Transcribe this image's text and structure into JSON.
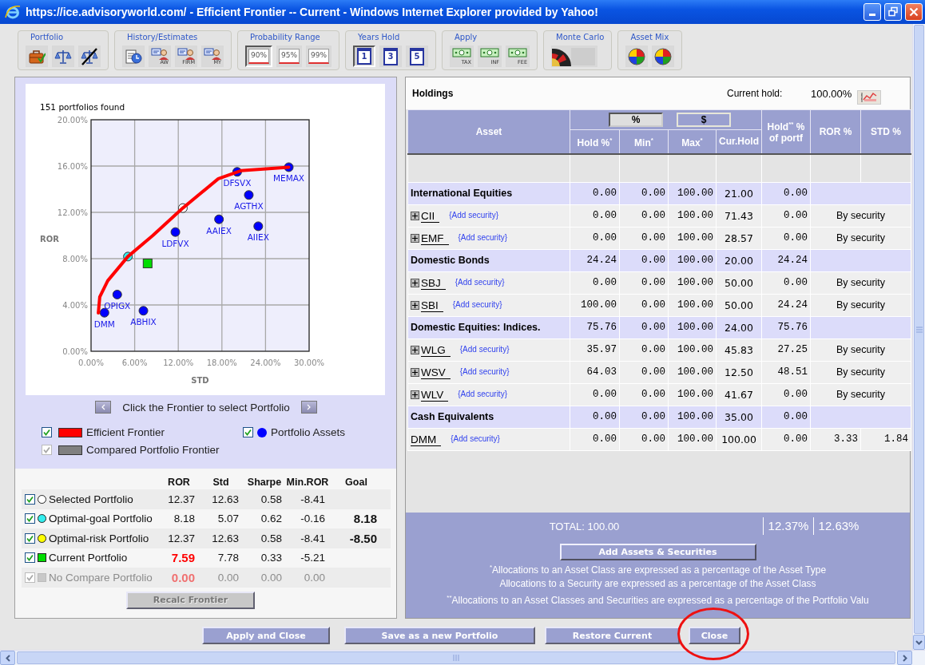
{
  "window": {
    "title": "https://ice.advisoryworld.com/ - Efficient Frontier -- Current - Windows Internet Explorer provided by Yahoo!"
  },
  "toolbar": [
    {
      "label": "Portfolio",
      "buttons": [
        {
          "kind": "briefcase"
        },
        {
          "kind": "scales"
        },
        {
          "kind": "scales-off"
        }
      ]
    },
    {
      "label": "History/Estimates",
      "buttons": [
        {
          "kind": "history"
        },
        {
          "kind": "person",
          "caption": "AW"
        },
        {
          "kind": "person",
          "caption": "FIRM"
        },
        {
          "kind": "person",
          "caption": "MY"
        }
      ]
    },
    {
      "label": "Probability Range",
      "buttons": [
        {
          "kind": "range",
          "caption": "90%",
          "selected": true
        },
        {
          "kind": "range",
          "caption": "95%",
          "selected": false
        },
        {
          "kind": "range",
          "caption": "99%",
          "selected": false
        }
      ]
    },
    {
      "label": "Years Hold",
      "buttons": [
        {
          "kind": "calendar",
          "caption": "1",
          "selected": true
        },
        {
          "kind": "calendar",
          "caption": "3",
          "selected": false
        },
        {
          "kind": "calendar",
          "caption": "5",
          "selected": false
        }
      ]
    },
    {
      "label": "Apply",
      "buttons": [
        {
          "kind": "money",
          "caption": "TAX"
        },
        {
          "kind": "money",
          "caption": "INF"
        },
        {
          "kind": "money",
          "caption": "FEE"
        }
      ]
    },
    {
      "label": "Monte Carlo",
      "buttons": [
        {
          "kind": "roulette"
        }
      ]
    },
    {
      "label": "Asset Mix",
      "buttons": [
        {
          "kind": "pie"
        },
        {
          "kind": "pie"
        }
      ]
    }
  ],
  "chart_data": {
    "type": "scatter",
    "grid": true,
    "title": "151 portfolios found",
    "xlabel": "STD",
    "ylabel": "ROR",
    "xlim": [
      0,
      30
    ],
    "ylim": [
      0,
      20
    ],
    "x": [
      1.0,
      1.2,
      1.84,
      2.3,
      3.6,
      5.07,
      7.2,
      7.78,
      8.5,
      11.6,
      12.63,
      17.5,
      17.6,
      20.1,
      20.6,
      21.7,
      23.0,
      27.2
    ],
    "xticks": [
      {
        "value": 0,
        "label": "0.00%"
      },
      {
        "value": 6,
        "label": "6.00%"
      },
      {
        "value": 12,
        "label": "12.00%"
      },
      {
        "value": 18,
        "label": "18.00%"
      },
      {
        "value": 24,
        "label": "24.00%"
      },
      {
        "value": 30,
        "label": "30.00%"
      }
    ],
    "yticks": [
      {
        "value": 0,
        "label": "0.00%"
      },
      {
        "value": 4,
        "label": "4.00%"
      },
      {
        "value": 8,
        "label": "8.00%"
      },
      {
        "value": 12,
        "label": "12.00%"
      },
      {
        "value": 16,
        "label": "16.00%"
      },
      {
        "value": 20,
        "label": "20.00%"
      }
    ],
    "series": [
      {
        "type": "line",
        "color": "#ff0000",
        "values": [
          3.3,
          4.7,
          null,
          6.1,
          null,
          8.18,
          null,
          null,
          10.0,
          null,
          12.37,
          14.9,
          null,
          null,
          15.6,
          null,
          null,
          15.9
        ]
      },
      {
        "color": "#0000ff",
        "values": [
          null,
          null,
          3.33,
          null,
          4.9,
          null,
          3.5,
          null,
          null,
          10.3,
          null,
          null,
          11.4,
          15.5,
          null,
          13.5,
          10.8,
          15.9
        ]
      },
      {
        "color": "#ffffff",
        "values": [
          null,
          null,
          null,
          null,
          null,
          null,
          null,
          null,
          null,
          null,
          12.37,
          null,
          null,
          null,
          null,
          null,
          null,
          null
        ]
      },
      {
        "color": "#33eeee",
        "values": [
          null,
          null,
          null,
          null,
          null,
          8.18,
          null,
          null,
          null,
          null,
          null,
          null,
          null,
          null,
          null,
          null,
          null,
          null
        ]
      },
      {
        "marker": "square",
        "color": "#00dd00",
        "values": [
          null,
          null,
          null,
          null,
          null,
          null,
          null,
          7.59,
          null,
          null,
          null,
          null,
          null,
          null,
          null,
          null,
          null,
          null
        ]
      }
    ],
    "annotations": [
      "DMM",
      "OPIGX",
      "ABHIX",
      "LDFVX",
      "AAIEX",
      "DFSVX",
      "AGTHX",
      "AIIEX",
      "MEMAX"
    ]
  },
  "nav_hint": "Click the Frontier to select Portfolio",
  "legend": [
    {
      "label": "Efficient Frontier",
      "kind": "swatch",
      "color": "#ff0000",
      "checked": true,
      "disabled": false
    },
    {
      "label": "Portfolio Assets",
      "kind": "dot",
      "color": "#0000ff",
      "checked": true,
      "disabled": false
    },
    {
      "label": "Compared Portfolio Frontier",
      "kind": "swatch",
      "color": "#808080",
      "checked": true,
      "disabled": true
    }
  ],
  "portfolios": {
    "columns": [
      "ROR",
      "Std",
      "Sharpe",
      "Min.ROR",
      "Goal"
    ],
    "rows": [
      {
        "name": "Selected Portfolio",
        "kind": "circle",
        "color": "#ffffff",
        "checked": true,
        "disabled": false,
        "emphasis": false,
        "ror": "12.37",
        "std": "12.63",
        "sharpe": "0.58",
        "min_ror": "-8.41"
      },
      {
        "name": "Optimal-goal Portfolio",
        "kind": "circle",
        "color": "#33eeee",
        "checked": true,
        "disabled": false,
        "emphasis": false,
        "ror": "8.18",
        "std": "5.07",
        "sharpe": "0.62",
        "min_ror": "-0.16",
        "goal": "8.18"
      },
      {
        "name": "Optimal-risk Portfolio",
        "kind": "circle",
        "color": "#ffff00",
        "checked": true,
        "disabled": false,
        "emphasis": false,
        "ror": "12.37",
        "std": "12.63",
        "sharpe": "0.58",
        "min_ror": "-8.41",
        "goal": "-8.50"
      },
      {
        "name": "Current Portfolio",
        "kind": "square",
        "color": "#00dd00",
        "checked": true,
        "disabled": false,
        "emphasis": true,
        "ror": "7.59",
        "std": "7.78",
        "sharpe": "0.33",
        "min_ror": "-5.21"
      },
      {
        "name": "No Compare Portfolio",
        "kind": "square",
        "color": "#c8c8c8",
        "checked": true,
        "disabled": true,
        "emphasis": true,
        "ror": "0.00",
        "std": "0.00",
        "sharpe": "0.00",
        "min_ror": "0.00"
      }
    ]
  },
  "recalc_button": {
    "label": "Recalc Frontier",
    "disabled": true
  },
  "holdings": {
    "title": "Holdings",
    "current_hold_label": "Current hold:",
    "current_hold": "100.00%",
    "units": [
      {
        "label": "%",
        "selected": true
      },
      {
        "label": "$",
        "selected": false
      }
    ],
    "columns": {
      "asset": "Asset",
      "hold": "Hold %$^{*}$",
      "min": "Min$^{*}$",
      "max": "Max$^{*}$",
      "cur_hold": "Cur.Hold",
      "hold_portf": "Hold$^{**}$ % of portf",
      "ror": "ROR %",
      "std": "STD %"
    },
    "rows": [
      {
        "kind": "category",
        "name": "International Equities",
        "hold": "0.00",
        "min": "0.00",
        "max": "100.00",
        "cur_hold": "21.00",
        "hold_portf": "0.00"
      },
      {
        "kind": "security",
        "ticker": "CII",
        "expandable": true,
        "link": "{Add security}",
        "hold": "0.00",
        "min": "0.00",
        "max": "100.00",
        "cur_hold": "71.43",
        "hold_portf": "0.00",
        "note": "By security"
      },
      {
        "kind": "security",
        "ticker": "EMF",
        "expandable": true,
        "link": "{Add security}",
        "hold": "0.00",
        "min": "0.00",
        "max": "100.00",
        "cur_hold": "28.57",
        "hold_portf": "0.00",
        "note": "By security"
      },
      {
        "kind": "category",
        "name": "Domestic Bonds",
        "hold": "24.24",
        "min": "0.00",
        "max": "100.00",
        "cur_hold": "20.00",
        "hold_portf": "24.24"
      },
      {
        "kind": "security",
        "ticker": "SBJ",
        "expandable": true,
        "link": "{Add security}",
        "hold": "0.00",
        "min": "0.00",
        "max": "100.00",
        "cur_hold": "50.00",
        "hold_portf": "0.00",
        "note": "By security"
      },
      {
        "kind": "security",
        "ticker": "SBI",
        "expandable": true,
        "link": "{Add security}",
        "hold": "100.00",
        "min": "0.00",
        "max": "100.00",
        "cur_hold": "50.00",
        "hold_portf": "24.24",
        "note": "By security"
      },
      {
        "kind": "category",
        "name": "Domestic Equities: Indices.",
        "hold": "75.76",
        "min": "0.00",
        "max": "100.00",
        "cur_hold": "24.00",
        "hold_portf": "75.76"
      },
      {
        "kind": "security",
        "ticker": "WLG",
        "expandable": true,
        "link": "{Add security}",
        "hold": "35.97",
        "min": "0.00",
        "max": "100.00",
        "cur_hold": "45.83",
        "hold_portf": "27.25",
        "note": "By security"
      },
      {
        "kind": "security",
        "ticker": "WSV",
        "expandable": true,
        "link": "{Add security}",
        "hold": "64.03",
        "min": "0.00",
        "max": "100.00",
        "cur_hold": "12.50",
        "hold_portf": "48.51",
        "note": "By security"
      },
      {
        "kind": "security",
        "ticker": "WLV",
        "expandable": true,
        "link": "{Add security}",
        "hold": "0.00",
        "min": "0.00",
        "max": "100.00",
        "cur_hold": "41.67",
        "hold_portf": "0.00",
        "note": "By security"
      },
      {
        "kind": "category",
        "name": "Cash Equivalents",
        "hold": "0.00",
        "min": "0.00",
        "max": "100.00",
        "cur_hold": "35.00",
        "hold_portf": "0.00"
      },
      {
        "kind": "security",
        "ticker": "DMM",
        "expandable": false,
        "link": "{Add security}",
        "hold": "0.00",
        "min": "0.00",
        "max": "100.00",
        "cur_hold": "100.00",
        "hold_portf": "0.00",
        "ror": "3.33",
        "std": "1.84"
      }
    ],
    "total": "TOTAL: 100.00",
    "total_ror": "12.37%",
    "total_std": "12.63%",
    "add_button": "Add Assets & Securities",
    "footnotes": [
      "$^{*}$Allocations to an Asset Class are expressed as a percentage of the Asset Type",
      "Allocations to a Security are expressed as a percentage of the Asset Class",
      "$^{**}$Allocations to an Asset Classes and Securities are expressed as a percentage of the Portfolio Valu"
    ]
  },
  "buttons": [
    {
      "label": "Apply and Close",
      "circled": false
    },
    {
      "label": "Save as a new Portfolio",
      "circled": false
    },
    {
      "label": "Restore Current",
      "circled": false
    },
    {
      "label": "Close",
      "circled": true
    }
  ]
}
